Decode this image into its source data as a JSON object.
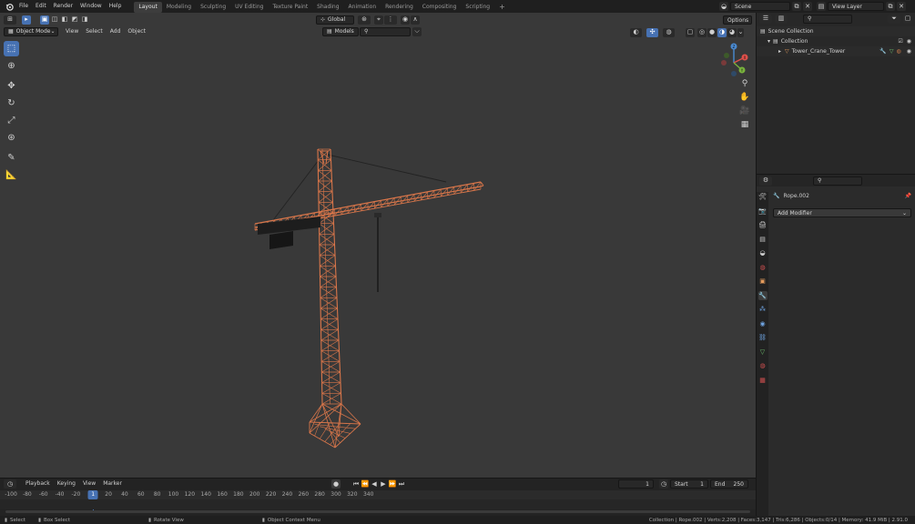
{
  "topbar": {
    "menus": [
      "File",
      "Edit",
      "Render",
      "Window",
      "Help"
    ],
    "workspaces": [
      "Layout",
      "Modeling",
      "Sculpting",
      "UV Editing",
      "Texture Paint",
      "Shading",
      "Animation",
      "Rendering",
      "Compositing",
      "Scripting"
    ],
    "active_workspace": "Layout",
    "scene_name": "Scene",
    "view_layer_name": "View Layer"
  },
  "viewport": {
    "mode": "Object Mode",
    "menus": [
      "View",
      "Select",
      "Add",
      "Object"
    ],
    "transform_orientation": "Global",
    "collection_filter": "Models",
    "options_label": "Options",
    "gizmo_axes": {
      "x": "X",
      "y": "Y",
      "z": "Z"
    }
  },
  "outliner": {
    "scene_collection": "Scene Collection",
    "collection": "Collection",
    "object": "Tower_Crane_Tower"
  },
  "properties": {
    "object_name": "Rope.002",
    "add_modifier": "Add Modifier"
  },
  "timeline": {
    "menus": [
      "Playback",
      "Keying",
      "View",
      "Marker"
    ],
    "current_frame": "1",
    "start_label": "Start",
    "start_value": "1",
    "end_label": "End",
    "end_value": "250",
    "playhead_label": "1",
    "ruler_ticks": [
      "-100",
      "-80",
      "-60",
      "-40",
      "-20",
      "20",
      "40",
      "60",
      "80",
      "100",
      "120",
      "140",
      "160",
      "180",
      "200",
      "220",
      "240",
      "260",
      "280",
      "300",
      "320",
      "340"
    ]
  },
  "statusbar": {
    "select": "Select",
    "box_select": "Box Select",
    "rotate_view": "Rotate View",
    "context_menu": "Object Context Menu",
    "stats": "Collection | Rope.002 | Verts:2,208 | Faces:3,147 | Tris:6,286 | Objects:0/14 | Memory: 41.9 MiB | 2.91.0"
  },
  "colors": {
    "accent": "#4772b3",
    "crane": "#d9764a",
    "viewport_bg": "#393939"
  }
}
